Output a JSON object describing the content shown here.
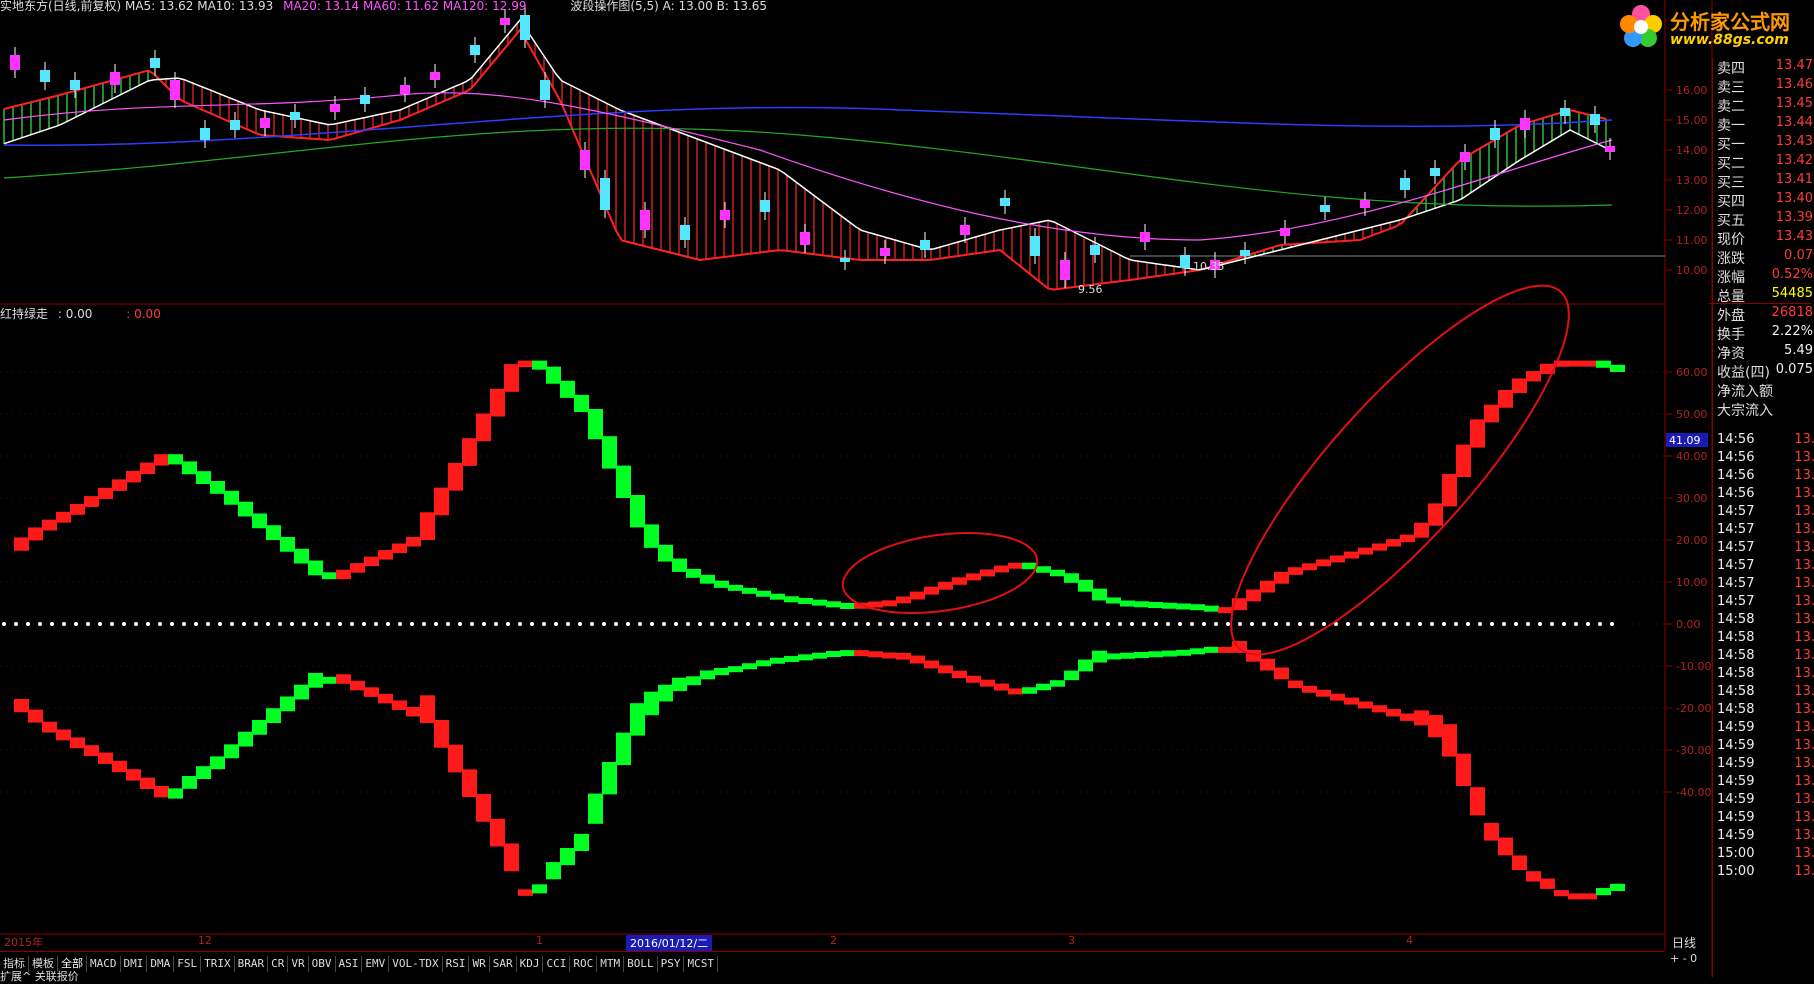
{
  "main_legend": {
    "text1": "实地东方(日线,前复权) MA5: 13.62 MA10: 13.93",
    "text2": "MA20: 13.14 MA60: 11.62 MA120: 12.99",
    "text3": "波段操作图(5,5) A: 13.00 B: 13.65"
  },
  "indicator_title": {
    "name": "红持绿走",
    "v1": ": 0.00",
    "v2": ": 0.00"
  },
  "price_axis": [
    "16.00",
    "15.00",
    "14.00",
    "13.00",
    "12.00",
    "11.00",
    "10.00"
  ],
  "ind_axis": [
    "60.00",
    "50.00",
    "40.00",
    "30.00",
    "20.00",
    "10.00",
    "0.00",
    "-10.00",
    "-20.00",
    "-30.00",
    "-40.00"
  ],
  "price_annotations": {
    "low": "9.56",
    "mid": "10.35"
  },
  "cursor_value": "41.09",
  "logo": {
    "brand": "分析家公式网",
    "url": "www.88gs.com"
  },
  "quote": [
    {
      "label": "卖四",
      "value": "13.47",
      "color": "red"
    },
    {
      "label": "卖三",
      "value": "13.46",
      "color": "red"
    },
    {
      "label": "卖二",
      "value": "13.45",
      "color": "red"
    },
    {
      "label": "卖一",
      "value": "13.44",
      "color": "red"
    },
    {
      "label": "买一",
      "value": "13.43",
      "color": "red"
    },
    {
      "label": "买二",
      "value": "13.42",
      "color": "red"
    },
    {
      "label": "买三",
      "value": "13.41",
      "color": "red"
    },
    {
      "label": "买四",
      "value": "13.40",
      "color": "red"
    },
    {
      "label": "买五",
      "value": "13.39",
      "color": "red"
    },
    {
      "label": "现价",
      "value": "13.43",
      "color": "red"
    },
    {
      "label": "涨跌",
      "value": "0.07",
      "color": "red"
    },
    {
      "label": "涨幅",
      "value": "0.52%",
      "color": "red"
    },
    {
      "label": "总量",
      "value": "54485",
      "color": "yellow"
    },
    {
      "label": "外盘",
      "value": "26818",
      "color": "red"
    },
    {
      "label": "换手",
      "value": "2.22%",
      "color": "white"
    },
    {
      "label": "净资",
      "value": "5.49",
      "color": "white"
    },
    {
      "label": "收益(四)",
      "value": "0.075",
      "color": "white"
    },
    {
      "label": "净流入额",
      "value": "",
      "color": "white"
    },
    {
      "label": "大宗流入",
      "value": "",
      "color": "white"
    }
  ],
  "ticks": [
    {
      "t": "14:56",
      "p": "13."
    },
    {
      "t": "14:56",
      "p": "13."
    },
    {
      "t": "14:56",
      "p": "13."
    },
    {
      "t": "14:56",
      "p": "13."
    },
    {
      "t": "14:57",
      "p": "13."
    },
    {
      "t": "14:57",
      "p": "13."
    },
    {
      "t": "14:57",
      "p": "13."
    },
    {
      "t": "14:57",
      "p": "13."
    },
    {
      "t": "14:57",
      "p": "13."
    },
    {
      "t": "14:57",
      "p": "13."
    },
    {
      "t": "14:58",
      "p": "13."
    },
    {
      "t": "14:58",
      "p": "13."
    },
    {
      "t": "14:58",
      "p": "13."
    },
    {
      "t": "14:58",
      "p": "13."
    },
    {
      "t": "14:58",
      "p": "13."
    },
    {
      "t": "14:58",
      "p": "13."
    },
    {
      "t": "14:59",
      "p": "13."
    },
    {
      "t": "14:59",
      "p": "13."
    },
    {
      "t": "14:59",
      "p": "13."
    },
    {
      "t": "14:59",
      "p": "13."
    },
    {
      "t": "14:59",
      "p": "13."
    },
    {
      "t": "14:59",
      "p": "13."
    },
    {
      "t": "14:59",
      "p": "13."
    },
    {
      "t": "15:00",
      "p": "13."
    },
    {
      "t": "15:00",
      "p": "13."
    }
  ],
  "date_axis": {
    "year": "2015年",
    "m12": "12",
    "m1": "1",
    "selected": "2016/01/12/二",
    "m2": "2",
    "m3": "3",
    "m4": "4"
  },
  "period": "日线",
  "tabs": [
    "指标",
    "模板",
    "全部",
    "MACD",
    "DMI",
    "DMA",
    "FSL",
    "TRIX",
    "BRAR",
    "CR",
    "VR",
    "OBV",
    "ASI",
    "EMV",
    "VOL-TDX",
    "RSI",
    "WR",
    "SAR",
    "KDJ",
    "CCI",
    "ROC",
    "MTM",
    "BOLL",
    "PSY",
    "MCST"
  ],
  "bottom_controls": "+ - 0",
  "expand_row": "扩展^  关联报价",
  "colors": {
    "up": "#ff1a1a",
    "down": "#00ff22",
    "bg": "#000000",
    "grid": "#8b0000"
  }
}
